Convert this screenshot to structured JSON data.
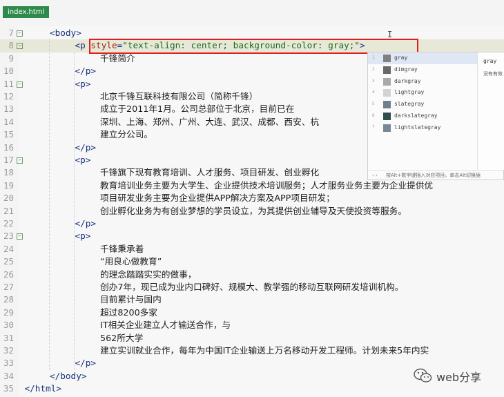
{
  "tab": {
    "filename": "index.html"
  },
  "editor": {
    "lines": [
      {
        "n": "7",
        "fold": true,
        "indent": 2,
        "kind": "tag",
        "text": "<body>"
      },
      {
        "n": "8",
        "fold": true,
        "indent": 3,
        "kind": "ptag",
        "current": true,
        "parts": {
          "open": "<p ",
          "attr": "style",
          "eq": "=",
          "val": "\"text-align: center; background-color: gray;\"",
          "close": ">"
        }
      },
      {
        "n": "9",
        "fold": false,
        "indent": 4,
        "kind": "text",
        "text": "千锋简介"
      },
      {
        "n": "10",
        "fold": false,
        "indent": 3,
        "kind": "tag",
        "text": "</p>"
      },
      {
        "n": "11",
        "fold": true,
        "indent": 3,
        "kind": "tag",
        "text": "<p>"
      },
      {
        "n": "12",
        "fold": false,
        "indent": 4,
        "kind": "text",
        "text": "北京千锋互联科技有限公司（简称千锋）"
      },
      {
        "n": "13",
        "fold": false,
        "indent": 4,
        "kind": "text",
        "text": "成立于2011年1月。公司总部位于北京，目前已在"
      },
      {
        "n": "14",
        "fold": false,
        "indent": 4,
        "kind": "text",
        "text": "深圳、上海、郑州、广州、大连、武汉、成都、西安、杭"
      },
      {
        "n": "15",
        "fold": false,
        "indent": 4,
        "kind": "text",
        "text": "建立分公司。"
      },
      {
        "n": "16",
        "fold": false,
        "indent": 3,
        "kind": "tag",
        "text": "</p>"
      },
      {
        "n": "17",
        "fold": true,
        "indent": 3,
        "kind": "tag",
        "text": "<p>"
      },
      {
        "n": "18",
        "fold": false,
        "indent": 4,
        "kind": "text",
        "text": "千锋旗下现有教育培训、人才服务、项目研发、创业孵化"
      },
      {
        "n": "19",
        "fold": false,
        "indent": 4,
        "kind": "text",
        "text": "教育培训业务主要为大学生、企业提供技术培训服务；人才服务业务主要为企业提供优"
      },
      {
        "n": "20",
        "fold": false,
        "indent": 4,
        "kind": "text",
        "text": "项目研发业务主要为企业提供APP解决方案及APP项目研发；"
      },
      {
        "n": "21",
        "fold": false,
        "indent": 4,
        "kind": "text",
        "text": "创业孵化业务为有创业梦想的学员设立，为其提供创业辅导及天使投资等服务。"
      },
      {
        "n": "22",
        "fold": false,
        "indent": 3,
        "kind": "tag",
        "text": "</p>"
      },
      {
        "n": "23",
        "fold": true,
        "indent": 3,
        "kind": "tag",
        "text": "<p>"
      },
      {
        "n": "24",
        "fold": false,
        "indent": 4,
        "kind": "text",
        "text": "千锋秉承着"
      },
      {
        "n": "25",
        "fold": false,
        "indent": 4,
        "kind": "text",
        "text": "“用良心做教育”"
      },
      {
        "n": "26",
        "fold": false,
        "indent": 4,
        "kind": "text",
        "text": "的理念踏踏实实的做事，"
      },
      {
        "n": "27",
        "fold": false,
        "indent": 4,
        "kind": "text",
        "text": "创办7年，现已成为业内口碑好、规模大、教学强的移动互联网研发培训机构。"
      },
      {
        "n": "28",
        "fold": false,
        "indent": 4,
        "kind": "text",
        "text": "目前累计与国内"
      },
      {
        "n": "29",
        "fold": false,
        "indent": 4,
        "kind": "text",
        "text": "超过8200多家"
      },
      {
        "n": "30",
        "fold": false,
        "indent": 4,
        "kind": "text",
        "text": "IT相关企业建立人才输送合作，与"
      },
      {
        "n": "31",
        "fold": false,
        "indent": 4,
        "kind": "text",
        "text": "562所大学"
      },
      {
        "n": "32",
        "fold": false,
        "indent": 4,
        "kind": "text",
        "text": "建立实训就业合作，每年为中国IT企业输送上万名移动开发工程师。计划未来5年内实"
      },
      {
        "n": "33",
        "fold": false,
        "indent": 3,
        "kind": "tag",
        "text": "</p>"
      },
      {
        "n": "34",
        "fold": false,
        "indent": 2,
        "kind": "tag",
        "text": "</body>"
      },
      {
        "n": "35",
        "fold": false,
        "indent": 1,
        "kind": "tag",
        "text": "</html>"
      }
    ]
  },
  "autocomplete": {
    "items": [
      {
        "index": "1",
        "name": "gray",
        "swatch": "#808080",
        "selected": true
      },
      {
        "index": "2",
        "name": "dimgray",
        "swatch": "#696969"
      },
      {
        "index": "3",
        "name": "darkgray",
        "swatch": "#a9a9a9"
      },
      {
        "index": "4",
        "name": "lightgray",
        "swatch": "#d3d3d3"
      },
      {
        "index": "5",
        "name": "slategray",
        "swatch": "#708090"
      },
      {
        "index": "6",
        "name": "darkslategray",
        "swatch": "#2f4f4f"
      },
      {
        "index": "7",
        "name": "lightslategray",
        "swatch": "#778899"
      }
    ],
    "detail_title": "gray",
    "detail_desc": "没有有效",
    "footer_chevrons": "‹ ›",
    "footer_hint": "按Alt+数字键插入对应项目。单击Alt切换插"
  },
  "watermark": {
    "text": "web分享",
    "icon": "wechat-icon"
  },
  "colors": {
    "tab_bg": "#2d8a4b",
    "highlight_border": "#e02020",
    "tag": "#16327a",
    "attr": "#9a2410",
    "string": "#1a6b1a",
    "selected_row": "#dfe7f5"
  }
}
